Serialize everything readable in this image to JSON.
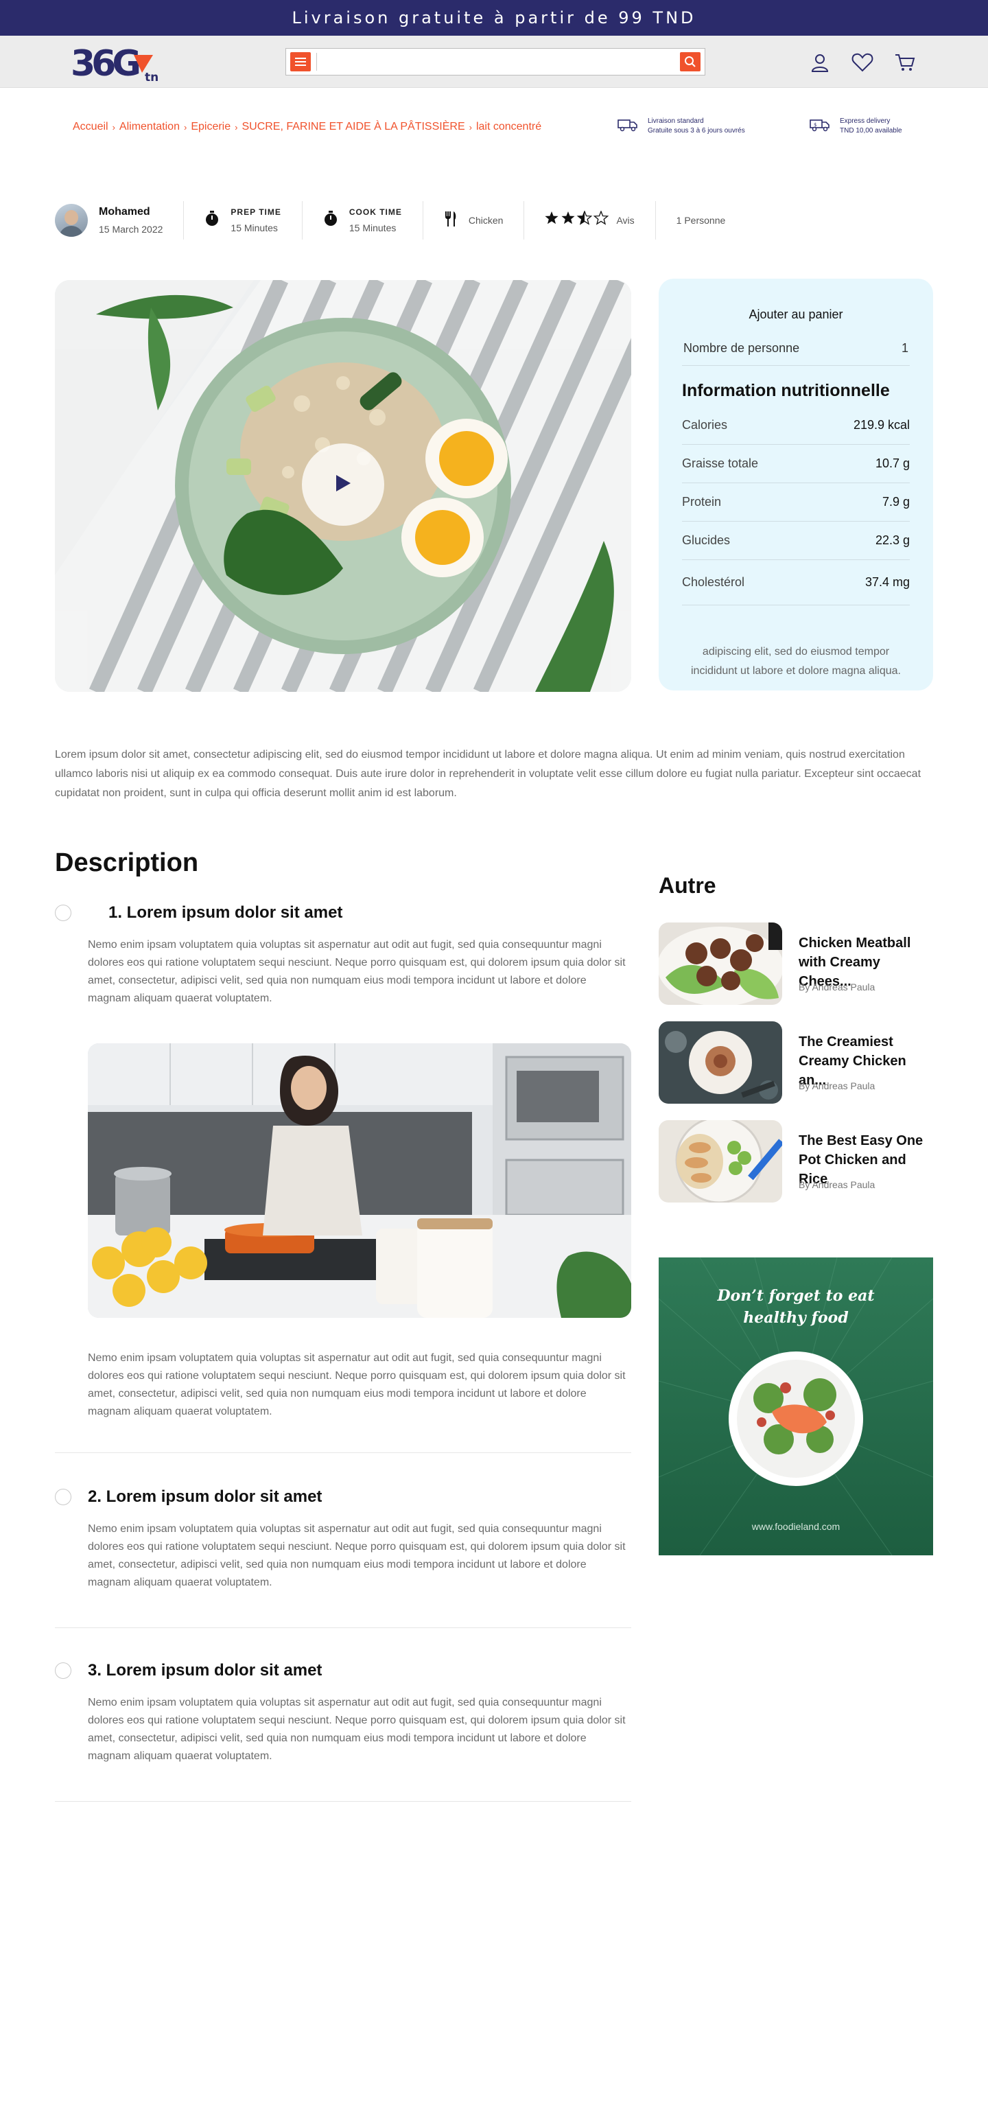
{
  "promo": {
    "text": "Livraison gratuite à partir de 99 TND"
  },
  "logo": {
    "main": "36G",
    "suffix": "tn"
  },
  "search": {
    "value": "",
    "placeholder": ""
  },
  "breadcrumb": [
    "Accueil",
    "Alimentation",
    "Epicerie",
    "SUCRE, FARINE ET AIDE À LA PÂTISSIÈRE",
    "lait concentré"
  ],
  "delivery": {
    "standard": {
      "title": "Livraison standard",
      "sub": "Gratuite sous 3 à 6 jours ouvrés"
    },
    "express": {
      "title": "Express delivery",
      "sub": "TND 10,00 available"
    }
  },
  "meta": {
    "author": "Mohamed",
    "date": "15 March 2022",
    "prep_label": "PREP TIME",
    "prep_value": "15 Minutes",
    "cook_label": "COOK TIME",
    "cook_value": "15 Minutes",
    "category": "Chicken",
    "rating": 2.5,
    "rating_text": "Avis",
    "persons": "1 Personne"
  },
  "nutrition": {
    "cart_label": "Ajouter au panier",
    "persons_label": "Nombre de personne",
    "persons_value": "1",
    "title": "Information nutritionnelle",
    "rows": [
      {
        "k": "Calories",
        "v": "219.9 kcal"
      },
      {
        "k": "Graisse totale",
        "v": "10.7 g"
      },
      {
        "k": "Protein",
        "v": "7.9 g"
      },
      {
        "k": "Glucides",
        "v": "22.3 g"
      },
      {
        "k": "Cholestérol",
        "v": "37.4 mg"
      }
    ],
    "footer": "adipiscing elit, sed do eiusmod tempor incididunt ut labore et dolore magna aliqua."
  },
  "intro": "Lorem ipsum dolor sit amet, consectetur adipiscing elit, sed do eiusmod tempor incididunt ut labore et dolore magna aliqua. Ut enim ad minim veniam, quis nostrud exercitation ullamco laboris nisi ut aliquip ex ea commodo consequat. Duis aute irure dolor in reprehenderit in voluptate velit esse cillum dolore eu fugiat nulla pariatur. Excepteur sint occaecat cupidatat non proident, sunt in culpa qui officia deserunt mollit anim id est laborum.",
  "description": {
    "title": "Description",
    "steps": [
      {
        "title": "1. Lorem ipsum dolor sit amet",
        "text": "Nemo enim ipsam voluptatem quia voluptas sit aspernatur aut odit aut fugit, sed quia consequuntur magni dolores eos qui ratione voluptatem sequi nesciunt. Neque porro quisquam est, qui dolorem ipsum quia dolor sit amet, consectetur, adipisci velit, sed quia non numquam eius modi tempora incidunt ut labore et dolore magnam aliquam quaerat voluptatem.",
        "text2": "Nemo enim ipsam voluptatem quia voluptas sit aspernatur aut odit aut fugit, sed quia consequuntur magni dolores eos qui ratione voluptatem sequi nesciunt. Neque porro quisquam est, qui dolorem ipsum quia dolor sit amet, consectetur, adipisci velit, sed quia non numquam eius modi tempora incidunt ut labore et dolore magnam aliquam quaerat voluptatem."
      },
      {
        "title": "2. Lorem ipsum dolor sit amet",
        "text": "Nemo enim ipsam voluptatem quia voluptas sit aspernatur aut odit aut fugit, sed quia consequuntur magni dolores eos qui ratione voluptatem sequi nesciunt. Neque porro quisquam est, qui dolorem ipsum quia dolor sit amet, consectetur, adipisci velit, sed quia non numquam eius modi tempora incidunt ut labore et dolore magnam aliquam quaerat voluptatem."
      },
      {
        "title": "3. Lorem ipsum dolor sit amet",
        "text": "Nemo enim ipsam voluptatem quia voluptas sit aspernatur aut odit aut fugit, sed quia consequuntur magni dolores eos qui ratione voluptatem sequi nesciunt. Neque porro quisquam est, qui dolorem ipsum quia dolor sit amet, consectetur, adipisci velit, sed quia non numquam eius modi tempora incidunt ut labore et dolore magnam aliquam quaerat voluptatem."
      }
    ]
  },
  "sidebar": {
    "title": "Autre",
    "cards": [
      {
        "title": "Chicken Meatball with Creamy Chees...",
        "author": "By Andreas Paula"
      },
      {
        "title": "The Creamiest Creamy Chicken an...",
        "author": "By Andreas Paula"
      },
      {
        "title": "The Best Easy One Pot Chicken and Rice",
        "author": "By Andreas Paula"
      }
    ],
    "ad": {
      "line1": "Don’t forget to eat",
      "line2": "healthy food",
      "url": "www.foodieland.com"
    }
  },
  "colors": {
    "brand_navy": "#2b2b6b",
    "accent_orange": "#f0522c",
    "card_bg": "#e6f7fd",
    "ad_green": "#2f7a57"
  }
}
